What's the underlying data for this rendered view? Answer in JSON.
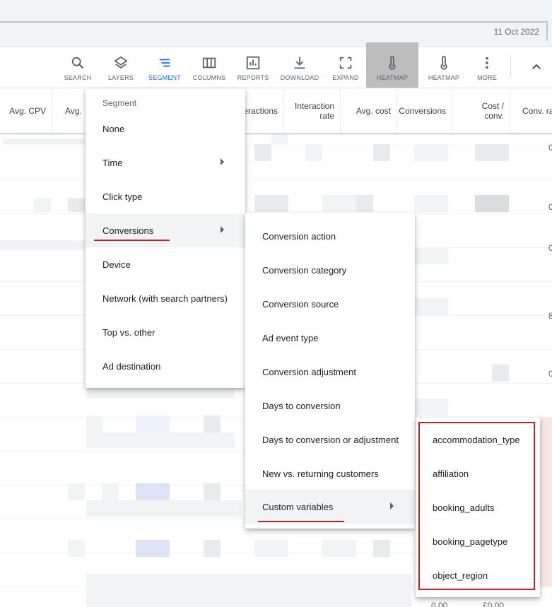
{
  "header": {
    "date": "11 Oct 2022"
  },
  "toolbar": {
    "search": "SEARCH",
    "layers": "LAYERS",
    "segment": "SEGMENT",
    "columns": "COLUMNS",
    "reports": "REPORTS",
    "download": "DOWNLOAD",
    "expand": "EXPAND",
    "heatmap_active": "HEATMAP",
    "heatmap": "HEATMAP",
    "more": "MORE"
  },
  "table": {
    "headers": [
      "Avg. CPV",
      "Avg.",
      "eractions",
      "Interaction rate",
      "Avg. cost",
      "Conversions",
      "Cost / conv.",
      "Conv. ra"
    ],
    "footer": {
      "conversions": "0.00",
      "cost_conv": "£0.00"
    }
  },
  "segment_menu": {
    "title": "Segment",
    "items": [
      "None",
      "Time",
      "Click type",
      "Conversions",
      "Device",
      "Network (with search partners)",
      "Top vs. other",
      "Ad destination"
    ]
  },
  "conversions_menu": {
    "items": [
      "Conversion action",
      "Conversion category",
      "Conversion source",
      "Ad event type",
      "Conversion adjustment",
      "Days to conversion",
      "Days to conversion or adjustment",
      "New vs. returning customers",
      "Custom variables"
    ]
  },
  "custom_variables_menu": {
    "items": [
      "accommodation_type",
      "affiliation",
      "booking_adults",
      "booking_pagetype",
      "object_region"
    ]
  },
  "colors": {
    "accent": "#1a73e8",
    "annotation_red": "#c5221f"
  }
}
